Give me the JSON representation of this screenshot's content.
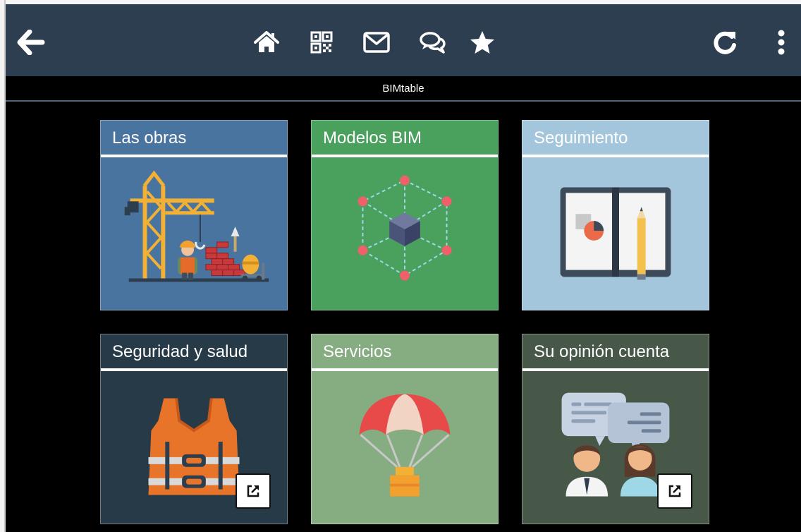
{
  "topbar": {
    "icons": [
      "back-arrow-icon",
      "home-icon",
      "qr-code-icon",
      "mail-icon",
      "chat-icon",
      "star-icon",
      "refresh-icon",
      "more-vertical-icon"
    ]
  },
  "app_title": "BIMtable",
  "tiles": [
    {
      "title": "Las obras",
      "color": "#4a74a0",
      "icon": "construction-crane-icon"
    },
    {
      "title": "Modelos BIM",
      "color": "#4aa05d",
      "icon": "bim-model-cube-icon"
    },
    {
      "title": "Seguimiento",
      "color": "#a4c6dc",
      "icon": "tracking-notebook-icon"
    },
    {
      "title": "Seguridad y salud",
      "color": "#263a48",
      "icon": "safety-vest-icon",
      "external_link_icon": "external-link-icon"
    },
    {
      "title": "Servicios",
      "color": "#86ac81",
      "icon": "parachute-icon"
    },
    {
      "title": "Su opinión cuenta",
      "color": "#485848",
      "icon": "feedback-chat-icon",
      "external_link_icon": "external-link-icon"
    }
  ]
}
